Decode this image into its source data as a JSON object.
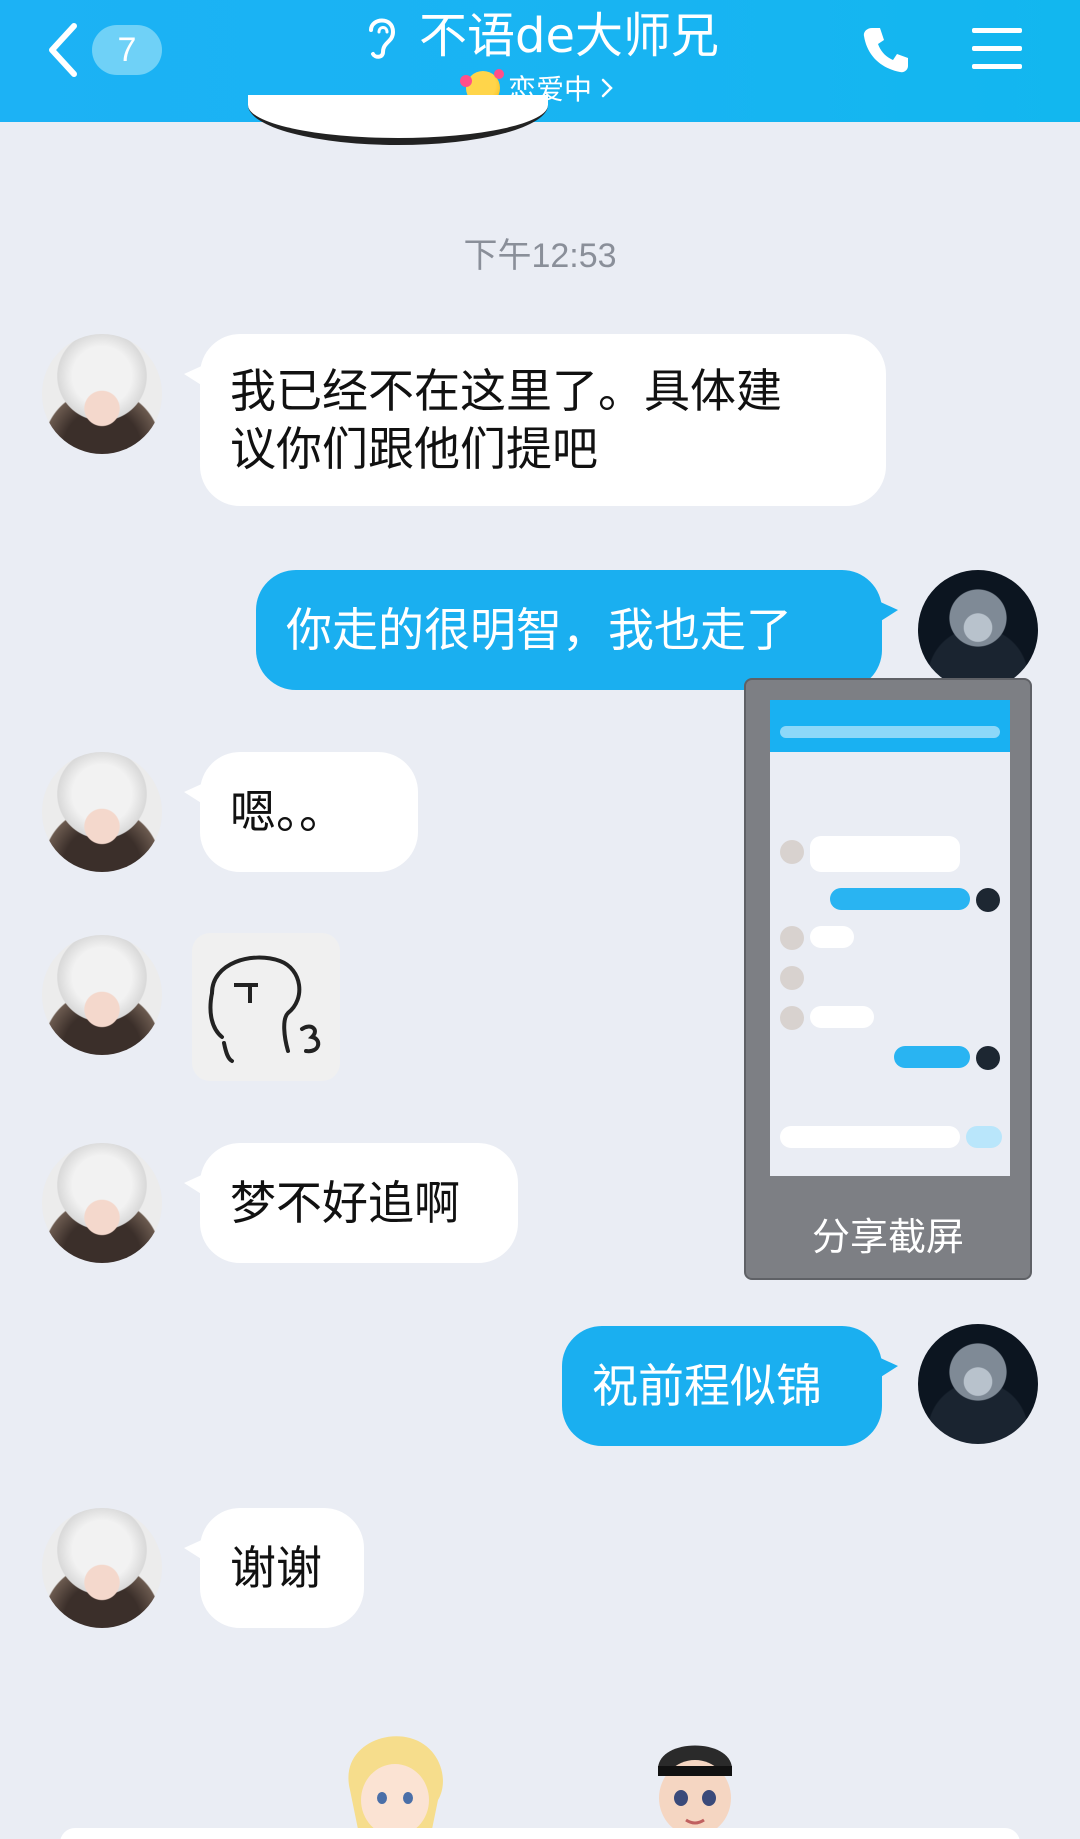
{
  "header": {
    "unread_count": "7",
    "contact_name": "不语de大师兄",
    "relationship_status": "恋爱中",
    "icons": [
      "back-chevron-icon",
      "ear-icon",
      "love-emoji-icon",
      "phone-icon",
      "menu-icon"
    ]
  },
  "timestamp": "下午12:53",
  "messages": [
    {
      "side": "left",
      "text": "我已经不在这里了。具体建\n议你们跟他们提吧"
    },
    {
      "side": "right",
      "text": "你走的很明智，我也走了"
    },
    {
      "side": "left",
      "text": "嗯。。"
    },
    {
      "side": "left",
      "type": "sticker"
    },
    {
      "side": "left",
      "text": "梦不好追啊"
    },
    {
      "side": "right",
      "text": "祝前程似锦"
    },
    {
      "side": "left",
      "text": "谢谢"
    }
  ],
  "share_popup": {
    "label": "分享截屏"
  },
  "colors": {
    "header": "#1cb2f5",
    "bubble_right": "#1aaff0",
    "background": "#eaedf4"
  }
}
